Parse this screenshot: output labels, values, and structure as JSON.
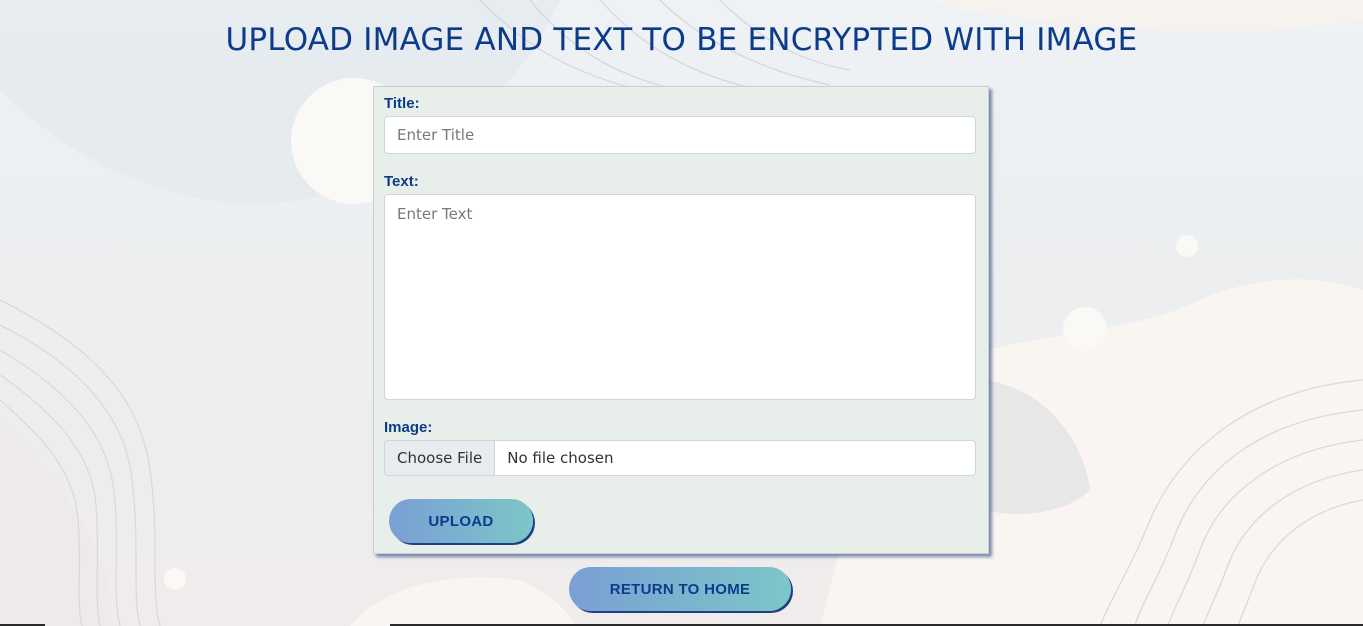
{
  "page": {
    "title": "UPLOAD IMAGE AND TEXT TO BE ENCRYPTED WITH IMAGE"
  },
  "form": {
    "title_label": "Title:",
    "title_placeholder": "Enter Title",
    "title_value": "",
    "text_label": "Text:",
    "text_placeholder": "Enter Text",
    "text_value": "",
    "image_label": "Image:",
    "file_button_label": "Choose File",
    "file_status": "No file chosen",
    "upload_label": "UPLOAD"
  },
  "nav": {
    "return_home_label": "RETURN TO HOME"
  },
  "colors": {
    "accent_text": "#0d3b8c",
    "button_gradient_start": "#7a9fd4",
    "button_gradient_end": "#7cc6c8",
    "card_background": "#e8eee9"
  }
}
